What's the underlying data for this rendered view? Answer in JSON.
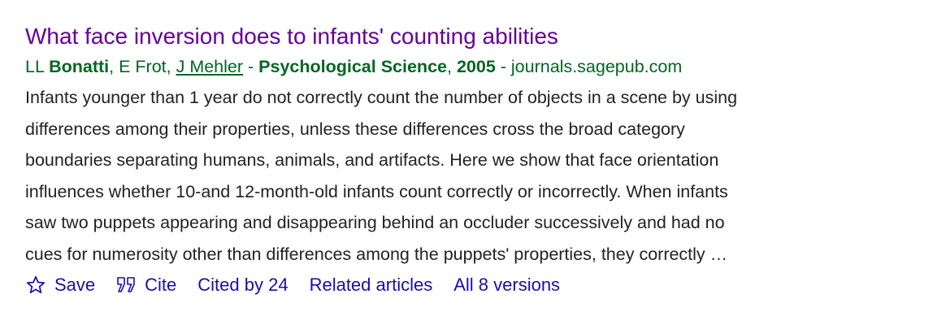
{
  "result": {
    "title": "What face inversion does to infants' counting abilities",
    "authors": {
      "prefix_initials": "LL ",
      "author1_name": "Bonatti",
      "sep1": ", ",
      "author2": "E Frot",
      "sep2": ", ",
      "author3_link": "J Mehler",
      "dash1": " - ",
      "journal": "Psychological Science",
      "sep3": ", ",
      "year": "2005",
      "dash2": " - ",
      "source": "journals.sagepub.com"
    },
    "snippet_lines": [
      "Infants younger than 1 year do not correctly count the number of objects in a scene by using",
      "differences among their properties, unless these differences cross the broad category",
      "boundaries separating humans, animals, and artifacts. Here we show that face orientation",
      "influences whether 10-and 12-month-old infants count correctly or incorrectly. When infants",
      "saw two puppets appearing and disappearing behind an occluder successively and had no",
      "cues for numerosity other than differences among the puppets' properties, they correctly …"
    ],
    "actions": {
      "save": "Save",
      "cite": "Cite",
      "cited_by": "Cited by 24",
      "related": "Related articles",
      "versions": "All 8 versions"
    }
  },
  "icons": {
    "save": "star-outline-icon",
    "cite": "quote-icon"
  },
  "colors": {
    "title": "#660099",
    "meta": "#006621",
    "snippet": "#222222",
    "links": "#1a0dab"
  }
}
